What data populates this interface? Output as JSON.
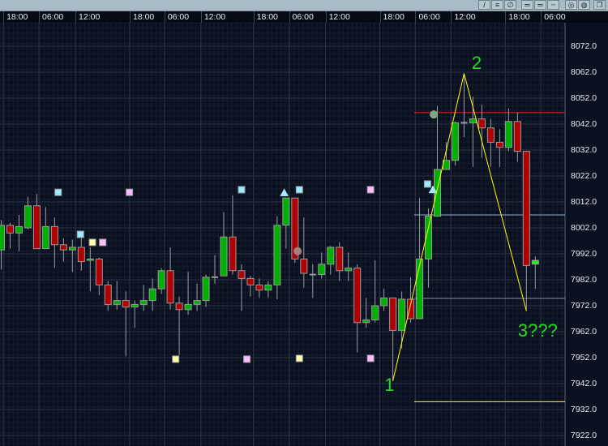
{
  "toolbar": {
    "buttons": [
      {
        "name": "trendline-button",
        "glyph": "/"
      },
      {
        "name": "hline-button",
        "glyph": "≡"
      },
      {
        "name": "pen-button",
        "glyph": "∅"
      },
      {
        "name": "line-style-1-button",
        "glyph": "═"
      },
      {
        "name": "line-style-2-button",
        "glyph": "═"
      },
      {
        "name": "line-style-3-button",
        "glyph": "┄"
      },
      {
        "name": "circle-1-button",
        "glyph": "◎"
      },
      {
        "name": "circle-2-button",
        "glyph": "◍"
      },
      {
        "name": "window-button",
        "glyph": "❐"
      }
    ]
  },
  "chart_data": {
    "type": "candlestick",
    "x_tick_labels": [
      "18:00",
      "06:00",
      "12:00",
      "18:00",
      "06:00",
      "12:00",
      "18:00",
      "06:00",
      "12:00",
      "18:00",
      "06:00",
      "12:00",
      "18:00",
      "06:00"
    ],
    "x_tick_bars": [
      0.6,
      4.6,
      8.7,
      14.8,
      18.7,
      22.8,
      28.7,
      32.7,
      36.8,
      42.9,
      46.9,
      50.9,
      57.0,
      61.0
    ],
    "y_tick_labels": [
      "8072.0",
      "8062.0",
      "8052.0",
      "8042.0",
      "8032.0",
      "8022.0",
      "8012.0",
      "8002.0",
      "7992.0",
      "7982.0",
      "7972.0",
      "7962.0",
      "7952.0",
      "7942.0",
      "7932.0",
      "7922.0"
    ],
    "ylim": [
      7916,
      8081
    ],
    "grid": true,
    "candles_ohlc": [
      [
        7993.5,
        8005,
        7986,
        8003
      ],
      [
        8003,
        8004,
        7994,
        8000
      ],
      [
        8000,
        8007,
        7993,
        8002.5
      ],
      [
        8002,
        8014,
        8001.5,
        8010.5
      ],
      [
        8010.5,
        8015,
        7994,
        7994
      ],
      [
        7994,
        8010,
        7994,
        8002.5
      ],
      [
        8002.5,
        8006,
        7986.5,
        7995.5
      ],
      [
        7995.5,
        7998,
        7989,
        7993.5
      ],
      [
        7993.5,
        7997.5,
        7985,
        7994.5
      ],
      [
        7994.5,
        7998,
        7985.5,
        7989
      ],
      [
        7989.5,
        7994.5,
        7977.5,
        7990
      ],
      [
        7990,
        7990.5,
        7976,
        7980
      ],
      [
        7980,
        7981.5,
        7970,
        7972.5
      ],
      [
        7972.5,
        7981.5,
        7970.5,
        7974
      ],
      [
        7974,
        7977.5,
        7952.5,
        7971.5
      ],
      [
        7971.5,
        7974,
        7963.5,
        7972.5
      ],
      [
        7972.5,
        7980,
        7970,
        7974
      ],
      [
        7974,
        7982.5,
        7970,
        7978.5
      ],
      [
        7978.5,
        7986.5,
        7976.5,
        7985.5
      ],
      [
        7985.5,
        7994.5,
        7970.5,
        7973
      ],
      [
        7973,
        7975.5,
        7953,
        7970.5
      ],
      [
        7970.5,
        7985,
        7968.5,
        7972.5
      ],
      [
        7972.5,
        7980.5,
        7970,
        7974
      ],
      [
        7974,
        7984,
        7971.5,
        7983
      ],
      [
        7983,
        7991.5,
        7980.5,
        7983
      ],
      [
        7983.5,
        8008,
        7983.5,
        7998.5
      ],
      [
        7998.5,
        8014.5,
        7984,
        7985.5
      ],
      [
        7985.5,
        7988,
        7970,
        7982.5
      ],
      [
        7982.5,
        7983.5,
        7975.5,
        7980
      ],
      [
        7980,
        7982.5,
        7975,
        7978
      ],
      [
        7978,
        7981.5,
        7975,
        7980
      ],
      [
        7980,
        8006.5,
        7974.5,
        8003
      ],
      [
        8003,
        8013.5,
        7994,
        8013.5
      ],
      [
        8013.5,
        8013.5,
        7988.5,
        7990
      ],
      [
        7990,
        8006,
        7979,
        7984.5
      ],
      [
        7984,
        7988,
        7975,
        7984
      ],
      [
        7984,
        7992.5,
        7982.5,
        7988
      ],
      [
        7988,
        7995,
        7984,
        7994.5
      ],
      [
        7994.5,
        7996.5,
        7981.5,
        7985.5
      ],
      [
        7985.5,
        7992.5,
        7981.5,
        7986.5
      ],
      [
        7986.5,
        7988,
        7954,
        7965.5
      ],
      [
        7965.5,
        7975,
        7963.5,
        7966.5
      ],
      [
        7966.5,
        7989.5,
        7965.5,
        7972
      ],
      [
        7972,
        7978.5,
        7970,
        7975
      ],
      [
        7975,
        7975,
        7943,
        7962.5
      ],
      [
        7962.5,
        7977.5,
        7955.5,
        7974.5
      ],
      [
        7974.5,
        7983,
        7965.5,
        7967
      ],
      [
        7967,
        8013.5,
        7967,
        7990
      ],
      [
        7990,
        8009.5,
        7979,
        8006.5
      ],
      [
        8006.5,
        8049,
        8006.5,
        8024.5
      ],
      [
        8024.5,
        8035,
        8024.5,
        8028
      ],
      [
        8028,
        8043,
        8026,
        8042.5
      ],
      [
        8042.5,
        8061.5,
        8037,
        8042.5
      ],
      [
        8042.5,
        8052.5,
        8025.5,
        8044
      ],
      [
        8044,
        8049.5,
        8029,
        8040.5
      ],
      [
        8040.5,
        8044,
        8025.5,
        8035
      ],
      [
        8035,
        8040,
        8025.5,
        8033
      ],
      [
        8033,
        8048,
        8031.5,
        8043
      ],
      [
        8043,
        8046.5,
        8027.5,
        8031.5
      ],
      [
        8031.5,
        8031.5,
        7970,
        7987.5
      ],
      [
        7988,
        7991,
        7978.5,
        7989.5
      ]
    ],
    "markers": [
      {
        "shape": "square",
        "color": "#99eeff",
        "bar": 6.4,
        "price": 8015.7
      },
      {
        "shape": "square",
        "color": "#ffbbff",
        "bar": 14.4,
        "price": 8015.7
      },
      {
        "shape": "square",
        "color": "#99eeff",
        "bar": 8.9,
        "price": 7999.5
      },
      {
        "shape": "square",
        "color": "#ffffaa",
        "bar": 10.25,
        "price": 7996.4
      },
      {
        "shape": "square",
        "color": "#ffbbff",
        "bar": 11.4,
        "price": 7996.4
      },
      {
        "shape": "square",
        "color": "#ffffaa",
        "bar": 19.6,
        "price": 7951.4
      },
      {
        "shape": "square",
        "color": "#99eeff",
        "bar": 27.0,
        "price": 8016.7
      },
      {
        "shape": "square",
        "color": "#ffbbff",
        "bar": 27.6,
        "price": 7951.4
      },
      {
        "shape": "square",
        "color": "#99eeff",
        "bar": 33.5,
        "price": 8016.7
      },
      {
        "shape": "square",
        "color": "#ffffaa",
        "bar": 33.5,
        "price": 7951.7
      },
      {
        "shape": "square",
        "color": "#ffbbff",
        "bar": 41.5,
        "price": 8016.7
      },
      {
        "shape": "square",
        "color": "#ffbbff",
        "bar": 41.5,
        "price": 7951.7
      },
      {
        "shape": "square",
        "color": "#99eeff",
        "bar": 47.9,
        "price": 8018.9
      },
      {
        "shape": "triangle",
        "color": "#99eeff",
        "bar": 31.8,
        "price": 8015.5
      },
      {
        "shape": "triangle",
        "color": "#99eeff",
        "bar": 48.5,
        "price": 8016.7
      },
      {
        "shape": "circle",
        "color": "#a08080",
        "bar": 33.3,
        "price": 7993.0
      },
      {
        "shape": "circle",
        "color": "#80a880",
        "bar": 48.6,
        "price": 8045.7
      }
    ],
    "hlines": [
      {
        "price": 8046.4,
        "color": "#ff1a1a",
        "from_bar": 46.4
      },
      {
        "price": 8007.0,
        "color": "#8fb0d8",
        "from_bar": 46.4
      },
      {
        "price": 7974.8,
        "color": "#8a8a8a",
        "from_bar": 46.4
      },
      {
        "price": 7935.0,
        "color": "#ffff00",
        "from_bar": 46.4
      }
    ],
    "wave": {
      "color": "#ffff00",
      "points": [
        {
          "bar": 44,
          "price": 7943
        },
        {
          "bar": 52,
          "price": 8061.5
        },
        {
          "bar": 59,
          "price": 7970
        }
      ],
      "labels": [
        {
          "text": "1",
          "bar": 43.6,
          "price": 7941
        },
        {
          "text": "2",
          "bar": 53.4,
          "price": 8065
        },
        {
          "text": "3???",
          "bar": 58.6,
          "price": 7962
        }
      ]
    },
    "colors": {
      "up": "#00b000",
      "down": "#b00000",
      "last": "#22ee22",
      "border": "#9a9a9a",
      "background": "#0a1020"
    }
  }
}
